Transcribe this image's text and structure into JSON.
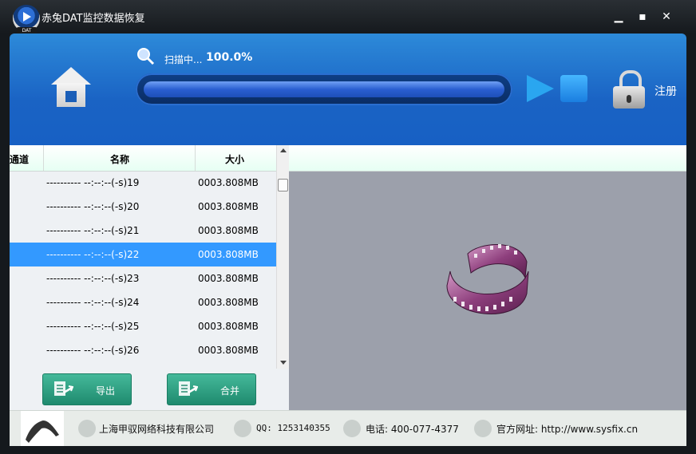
{
  "titlebar": {
    "title": "赤兔DAT监控数据恢复",
    "logo_tag": "DAT"
  },
  "header": {
    "scan_label": "扫描中...",
    "progress_text": "100.0%",
    "progress_value": 1.0,
    "register_label": "注册"
  },
  "table": {
    "columns": [
      "通道",
      "名称",
      "大小"
    ],
    "rows": [
      {
        "name": "---------- --:--:--(-s)19",
        "size": "0003.808MB"
      },
      {
        "name": "---------- --:--:--(-s)20",
        "size": "0003.808MB"
      },
      {
        "name": "---------- --:--:--(-s)21",
        "size": "0003.808MB"
      },
      {
        "name": "---------- --:--:--(-s)22",
        "size": "0003.808MB",
        "selected": true
      },
      {
        "name": "---------- --:--:--(-s)23",
        "size": "0003.808MB"
      },
      {
        "name": "---------- --:--:--(-s)24",
        "size": "0003.808MB"
      },
      {
        "name": "---------- --:--:--(-s)25",
        "size": "0003.808MB"
      },
      {
        "name": "---------- --:--:--(-s)26",
        "size": "0003.808MB"
      }
    ]
  },
  "buttons": {
    "export": "导出",
    "merge": "合并"
  },
  "footer": {
    "company": "上海甲驭网络科技有限公司",
    "qq": "QQ: 1253140355",
    "phone": "电话: 400-077-4377",
    "website": "官方网址: http://www.sysfix.cn"
  },
  "colors": {
    "header_blue": "#1a63c4",
    "selection": "#3399ff",
    "button_green": "#2fa583",
    "preview_bg": "#9ca0ab"
  }
}
